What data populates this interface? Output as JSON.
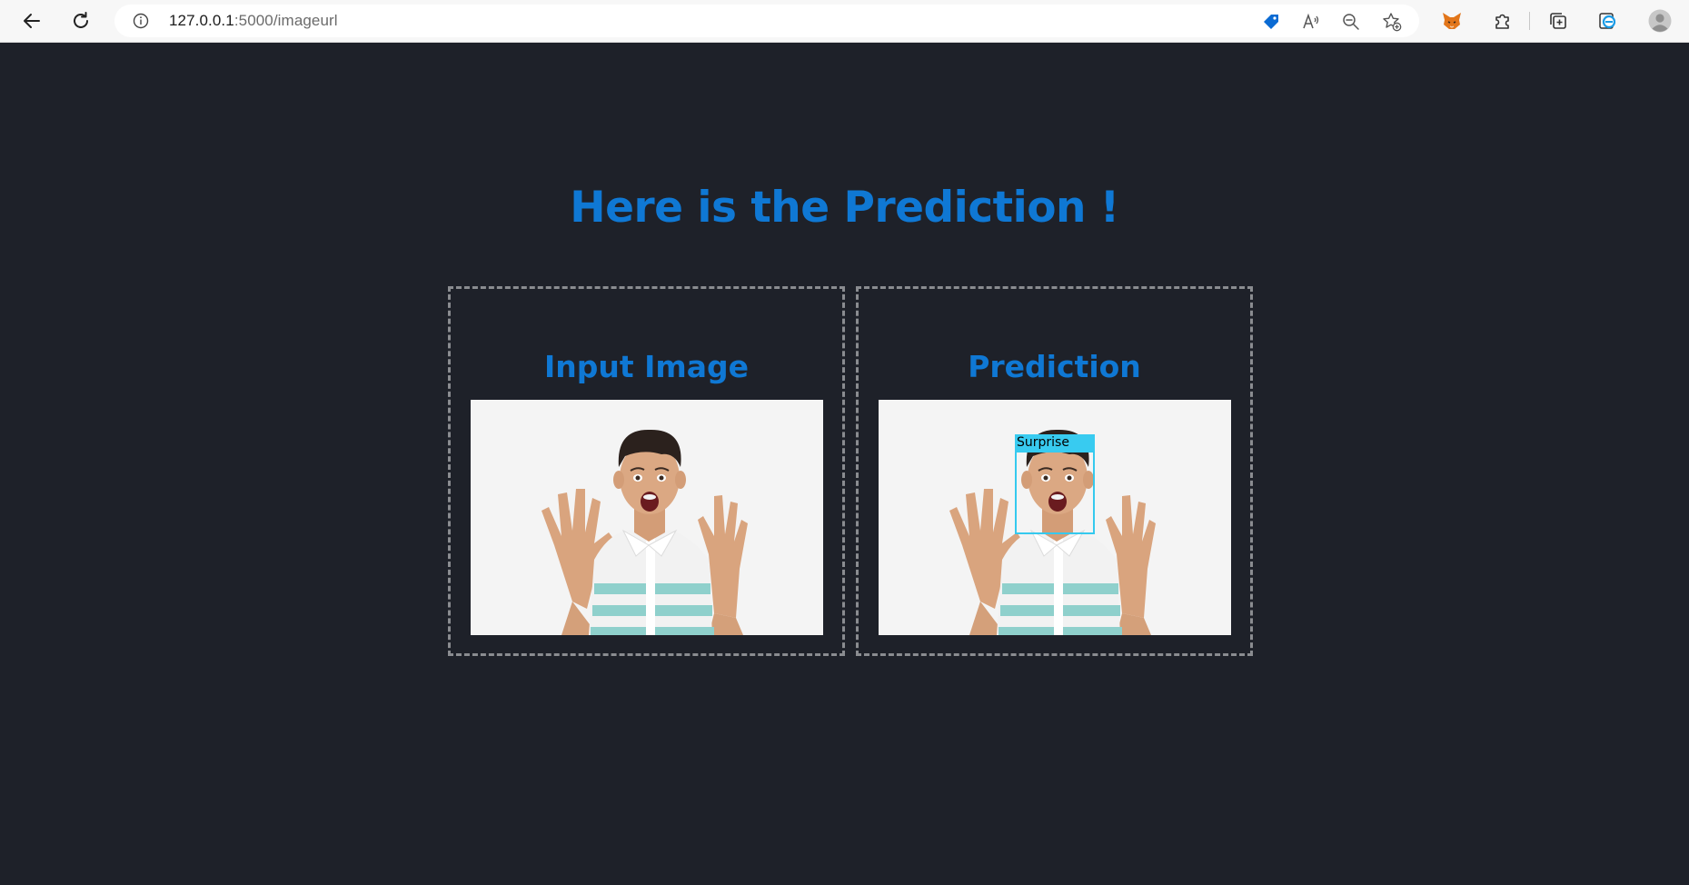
{
  "browser": {
    "url_host": "127.0.0.1",
    "url_path": ":5000/imageurl",
    "icons": {
      "back": "arrow-left-icon",
      "refresh": "refresh-icon",
      "info": "info-icon",
      "shopping": "tag-icon",
      "read_aloud": "read-aloud-icon",
      "zoom": "zoom-out-icon",
      "favorite": "add-favorite-icon",
      "metamask": "fox-extension-icon",
      "extensions": "puzzle-icon",
      "collections": "collections-icon",
      "edge": "edge-icon",
      "profile": "profile-avatar-icon"
    }
  },
  "page": {
    "title": "Here is the Prediction !",
    "input_panel": {
      "heading": "Input Image"
    },
    "prediction_panel": {
      "heading": "Prediction",
      "box_label": "Surprise"
    }
  },
  "colors": {
    "background": "#1e2129",
    "heading": "#0f78d4",
    "bbox": "#38cbf0",
    "panel_border": "#8a8c90"
  }
}
